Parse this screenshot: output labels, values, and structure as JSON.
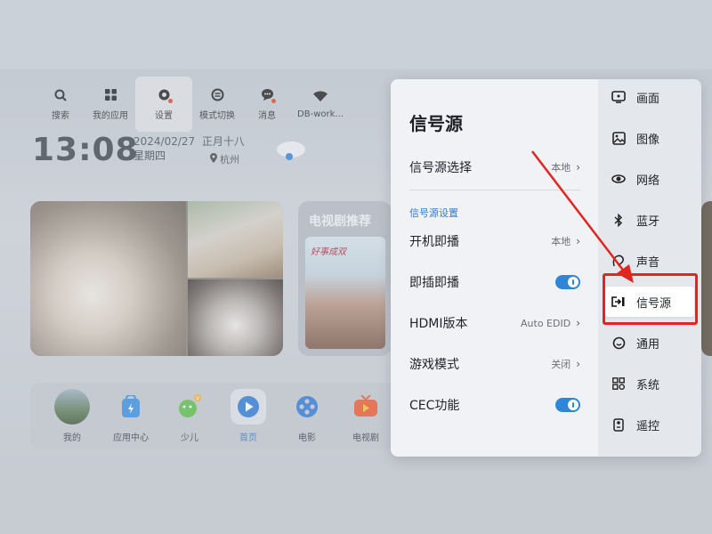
{
  "topnav": [
    {
      "label": "搜索",
      "icon": "search-icon"
    },
    {
      "label": "我的应用",
      "icon": "apps-grid-icon"
    },
    {
      "label": "设置",
      "icon": "settings-icon",
      "active": true
    },
    {
      "label": "模式切换",
      "icon": "mode-switch-icon"
    },
    {
      "label": "消息",
      "icon": "message-icon"
    },
    {
      "label": "DB-work...",
      "icon": "wifi-icon"
    }
  ],
  "home": {
    "clock": "13:08",
    "date": "2024/02/27",
    "lunar": "正月十八",
    "weekday": "星期四",
    "city": "杭州",
    "drama_title": "电视剧推荐",
    "poster_text": "好事成双"
  },
  "dock": [
    {
      "label": "我的",
      "icon": "profile-avatar-icon"
    },
    {
      "label": "应用中心",
      "icon": "app-center-icon"
    },
    {
      "label": "少儿",
      "icon": "kids-icon"
    },
    {
      "label": "首页",
      "icon": "home-play-icon",
      "active": true
    },
    {
      "label": "电影",
      "icon": "film-reel-icon"
    },
    {
      "label": "电视剧",
      "icon": "tv-series-icon"
    }
  ],
  "panel": {
    "title": "信号源",
    "source_select": {
      "label": "信号源选择",
      "value": "本地"
    },
    "section_label": "信号源设置",
    "boot_play": {
      "label": "开机即播",
      "value": "本地"
    },
    "plug_play": {
      "label": "即插即播",
      "on": true
    },
    "hdmi_version": {
      "label": "HDMI版本",
      "value": "Auto EDID"
    },
    "game_mode": {
      "label": "游戏模式",
      "value": "关闭"
    },
    "cec": {
      "label": "CEC功能",
      "on": true
    }
  },
  "sidebar": {
    "items": [
      {
        "label": "画面",
        "icon": "picture-icon"
      },
      {
        "label": "图像",
        "icon": "image-icon"
      },
      {
        "label": "网络",
        "icon": "network-icon"
      },
      {
        "label": "蓝牙",
        "icon": "bluetooth-icon"
      },
      {
        "label": "声音",
        "icon": "sound-icon"
      },
      {
        "label": "信号源",
        "icon": "signal-source-icon",
        "active": true
      },
      {
        "label": "通用",
        "icon": "general-icon"
      },
      {
        "label": "系统",
        "icon": "system-icon"
      },
      {
        "label": "遥控",
        "icon": "remote-icon"
      }
    ]
  },
  "colors": {
    "accent": "#2f86d9",
    "highlight": "#e0261e",
    "panel_bg": "#f0f2f5",
    "sidebar_bg": "#e4e7eb"
  }
}
